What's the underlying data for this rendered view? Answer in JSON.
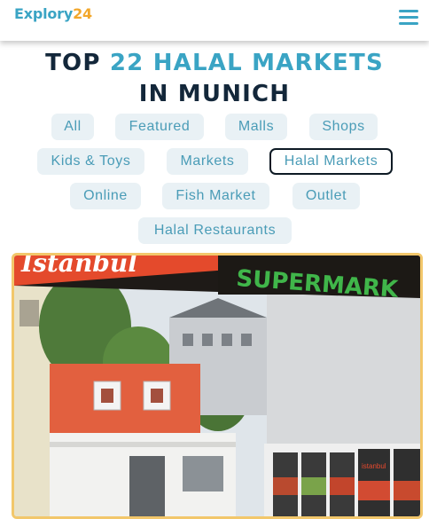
{
  "header": {
    "logo_part1": "Explory",
    "logo_part2": "24",
    "menu_icon": "hamburger-menu-icon",
    "accent_color": "#3aa4c4",
    "logo_accent_color": "#f2a72b"
  },
  "title": {
    "prefix": "TOP ",
    "highlight": "22 HALAL MARKETS",
    "suffix": " IN MUNICH"
  },
  "categories": [
    {
      "label": "All"
    },
    {
      "label": "Featured"
    },
    {
      "label": "Malls"
    },
    {
      "label": "Shops"
    },
    {
      "label": "Kids & Toys"
    },
    {
      "label": "Markets"
    },
    {
      "label": "Halal Markets",
      "active": true
    },
    {
      "label": "Online"
    },
    {
      "label": "Fish Market"
    },
    {
      "label": "Outlet"
    },
    {
      "label": "Halal Restaurants"
    }
  ],
  "hero": {
    "sign_text": "SUPERMARK",
    "sign_script": "Istanbul",
    "shelf_label": "istanbul"
  }
}
